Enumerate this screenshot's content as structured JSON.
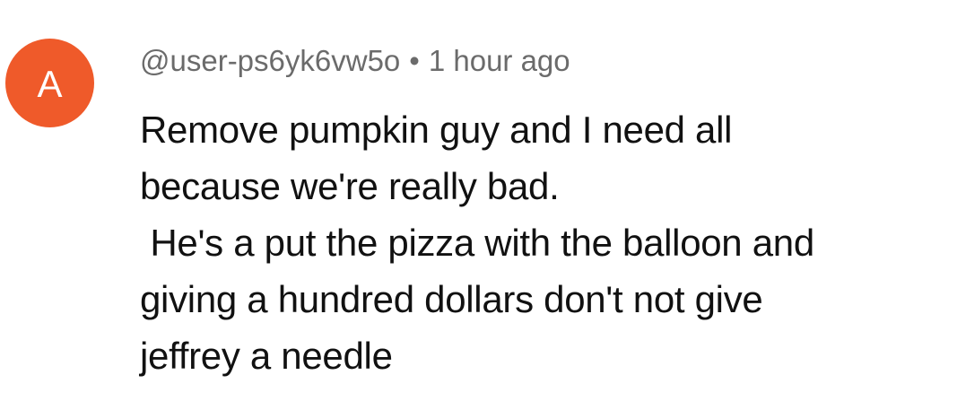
{
  "comment": {
    "avatar_letter": "A",
    "avatar_color": "#ef5a2a",
    "username": "@user-ps6yk6vw5o",
    "separator": "•",
    "timestamp": "1 hour ago",
    "lines": [
      "Remove pumpkin guy and I need all",
      "because we're really bad.",
      " He's a put the pizza with the balloon and",
      "giving a hundred dollars don't not give",
      "jeffrey a needle"
    ]
  }
}
